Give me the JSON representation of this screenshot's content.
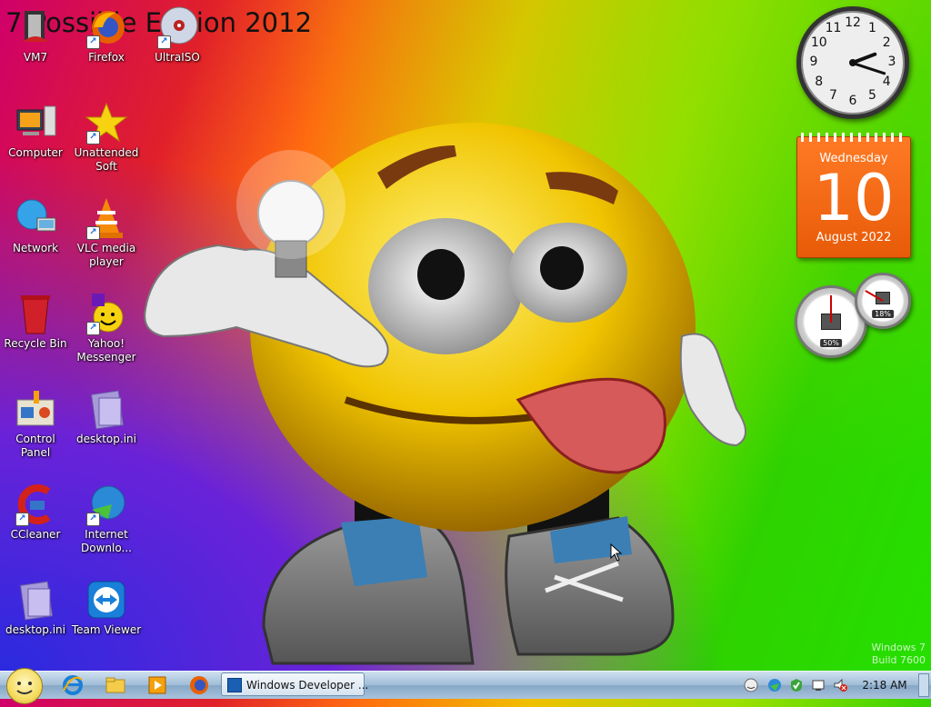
{
  "wallpaper_title": "7 Possible Edition 2012",
  "desktop_icons": [
    {
      "label": "VM7"
    },
    {
      "label": "Firefox"
    },
    {
      "label": "UltraISO"
    },
    {
      "label": "Computer"
    },
    {
      "label": "Unattended Soft"
    },
    {
      "label": "Network"
    },
    {
      "label": "VLC media player"
    },
    {
      "label": "Recycle Bin"
    },
    {
      "label": "Yahoo! Messenger"
    },
    {
      "label": "Control Panel"
    },
    {
      "label": "desktop.ini"
    },
    {
      "label": "CCleaner"
    },
    {
      "label": "Internet Downlo..."
    },
    {
      "label": "desktop.ini"
    },
    {
      "label": "Team Viewer"
    }
  ],
  "calendar": {
    "weekday": "Wednesday",
    "day": "10",
    "month_year": "August 2022"
  },
  "clock": {
    "numbers": [
      "12",
      "1",
      "2",
      "3",
      "4",
      "5",
      "6",
      "7",
      "8",
      "9",
      "10",
      "11"
    ],
    "hour": 2,
    "minute": 18
  },
  "cpu_meter": {
    "cpu": "50%",
    "memory": "18%"
  },
  "watermark": {
    "line1": "Windows 7",
    "line2": "Build 7600"
  },
  "taskbar": {
    "window_button": "Windows Developer ...",
    "time": "2:18 AM"
  }
}
